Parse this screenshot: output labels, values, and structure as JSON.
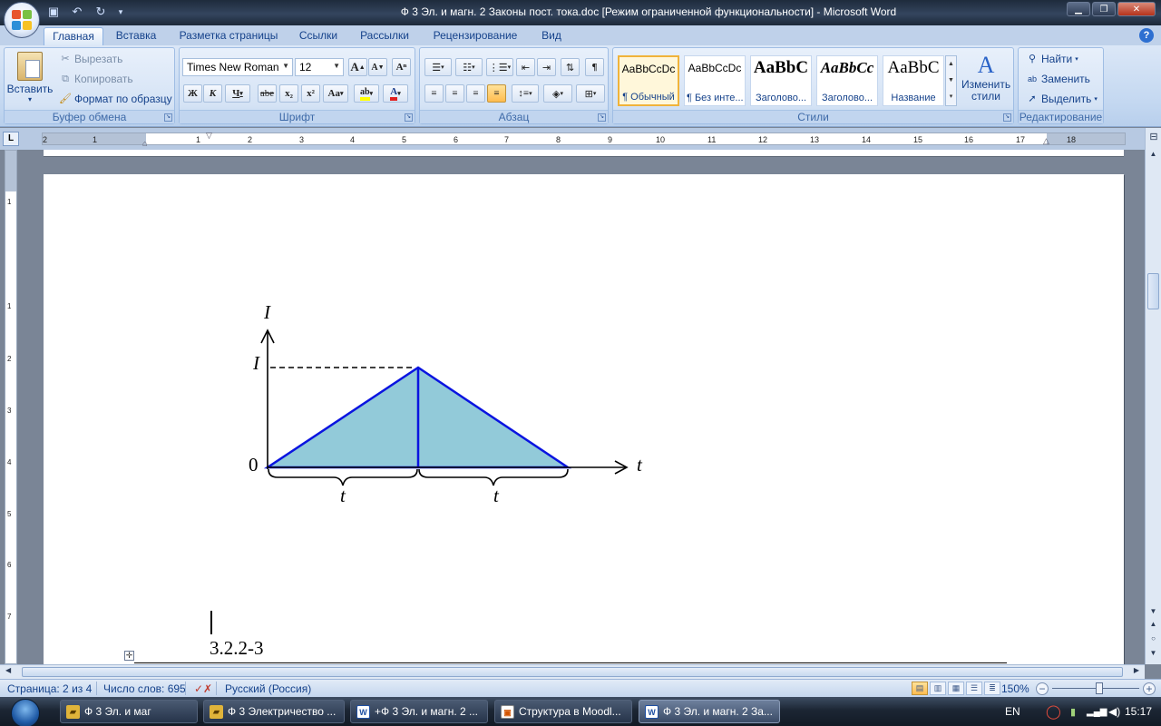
{
  "window": {
    "title": "Ф 3 Эл. и магн. 2 Законы пост. тока.doc [Режим ограниченной функциональности] - Microsoft Word"
  },
  "quick_access": [
    {
      "icon": "save-icon",
      "glyph": "💾"
    },
    {
      "icon": "undo-icon",
      "glyph": "↶"
    },
    {
      "icon": "redo-icon",
      "glyph": "↻"
    },
    {
      "icon": "customize-icon",
      "glyph": "▾"
    }
  ],
  "tabs": [
    "Главная",
    "Вставка",
    "Разметка страницы",
    "Ссылки",
    "Рассылки",
    "Рецензирование",
    "Вид"
  ],
  "ribbon": {
    "clipboard": {
      "label": "Буфер обмена",
      "paste": "Вставить",
      "cut": "Вырезать",
      "copy": "Копировать",
      "format_painter": "Формат по образцу"
    },
    "font": {
      "label": "Шрифт",
      "font_name": "Times New Roman",
      "font_size": "12",
      "grow": "A",
      "shrink": "A",
      "bold": "Ж",
      "italic": "К",
      "underline": "Ч",
      "strike": "abe",
      "subscript": "x₂",
      "superscript": "x²",
      "case": "Aa",
      "highlight": "ab",
      "font_color": "A"
    },
    "paragraph": {
      "label": "Абзац",
      "show_marks": "¶"
    },
    "styles": {
      "label": "Стили",
      "items": [
        {
          "sample": "AaBbCcDc",
          "name": "¶ Обычный"
        },
        {
          "sample": "AaBbCcDc",
          "name": "¶ Без инте..."
        },
        {
          "sample": "AaBbC",
          "name": "Заголово..."
        },
        {
          "sample": "AaBbCc",
          "name": "Заголово..."
        },
        {
          "sample": "AaBbC",
          "name": "Название"
        }
      ],
      "change_styles": "Изменить стили"
    },
    "editing": {
      "label": "Редактирование",
      "find": "Найти",
      "replace": "Заменить",
      "select": "Выделить"
    }
  },
  "ruler": {
    "toggle": "L",
    "h_ticks": [
      "2",
      "1",
      "1",
      "2",
      "3",
      "4",
      "5",
      "6",
      "7",
      "8",
      "9",
      "10",
      "11",
      "12",
      "13",
      "14",
      "15",
      "16",
      "17",
      "18"
    ],
    "v_ticks": [
      "1",
      "1",
      "2",
      "3",
      "4",
      "5",
      "6",
      "7"
    ]
  },
  "document": {
    "figure": {
      "y_axis_label": "I",
      "x_axis_label": "t",
      "peak_label": "I",
      "origin_label": "0",
      "interval_label_1": "t",
      "interval_label_2": "t",
      "fill_color": "#92cad9",
      "line_color": "#0a14e0"
    },
    "section_number": "3.2.2-3"
  },
  "statusbar": {
    "page": "Страница: 2 из 4",
    "words": "Число слов: 695",
    "language": "Русский (Россия)",
    "zoom": "150%"
  },
  "taskbar": {
    "items": [
      "Ф 3 Эл. и маг",
      "Ф 3 Электричество ...",
      "+Ф 3 Эл. и магн. 2 ...",
      "Структура в Moodl...",
      "Ф 3 Эл. и магн. 2 За..."
    ],
    "lang": "EN",
    "time": "15:17"
  }
}
